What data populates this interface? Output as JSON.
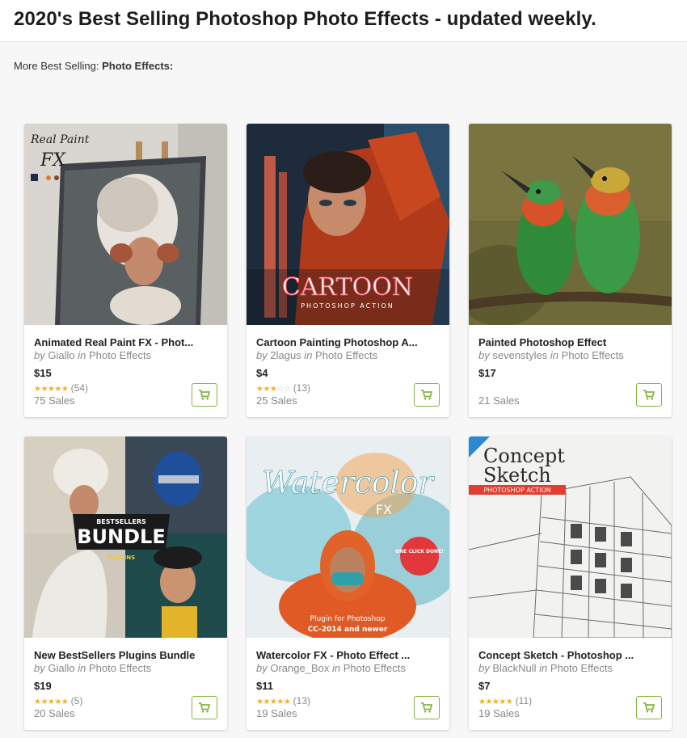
{
  "header": {
    "title": "2020's Best Selling Photoshop Photo Effects - updated weekly."
  },
  "breadcrumb": {
    "prefix": "More Best Selling:",
    "category": "Photo Effects:"
  },
  "colors": {
    "accent_green": "#82b541",
    "star": "#f0b323"
  },
  "products": [
    {
      "title": "Animated Real Paint FX - Phot...",
      "by_word": "by",
      "author": "Giallo",
      "in_word": "in",
      "category": "Photo Effects",
      "price": "$15",
      "stars": "★★★★★",
      "stars_off": "",
      "rating_count": "(54)",
      "sales": "75 Sales",
      "image_text": [
        "Real Paint",
        "FX"
      ]
    },
    {
      "title": "Cartoon Painting Photoshop A...",
      "by_word": "by",
      "author": "2lagus",
      "in_word": "in",
      "category": "Photo Effects",
      "price": "$4",
      "stars": "★★★",
      "stars_off": "☆☆",
      "rating_count": "(13)",
      "sales": "25 Sales",
      "image_text": [
        "CARTOON",
        "PHOTOSHOP ACTION"
      ]
    },
    {
      "title": "Painted Photoshop Effect",
      "by_word": "by",
      "author": "sevenstyles",
      "in_word": "in",
      "category": "Photo Effects",
      "price": "$17",
      "stars": "",
      "stars_off": "",
      "rating_count": "",
      "sales": "21 Sales",
      "image_text": []
    },
    {
      "title": "New BestSellers Plugins Bundle",
      "by_word": "by",
      "author": "Giallo",
      "in_word": "in",
      "category": "Photo Effects",
      "price": "$19",
      "stars": "★★★★★",
      "stars_off": "",
      "rating_count": "(5)",
      "sales": "20 Sales",
      "image_text": [
        "BESTSELLERS",
        "BUNDLE",
        "PLUGINS"
      ]
    },
    {
      "title": "Watercolor FX - Photo Effect ...",
      "by_word": "by",
      "author": "Orange_Box",
      "in_word": "in",
      "category": "Photo Effects",
      "price": "$11",
      "stars": "★★★★★",
      "stars_off": "",
      "rating_count": "(13)",
      "sales": "19 Sales",
      "image_text": [
        "Watercolor",
        "FX",
        "ONE CLICK DONE!",
        "Plugin for Photoshop",
        "CC-2014 and newer"
      ]
    },
    {
      "title": "Concept Sketch - Photoshop ...",
      "by_word": "by",
      "author": "BlackNull",
      "in_word": "in",
      "category": "Photo Effects",
      "price": "$7",
      "stars": "★★★★★",
      "stars_off": "",
      "rating_count": "(11)",
      "sales": "19 Sales",
      "image_text": [
        "Concept",
        "Sketch",
        "PHOTOSHOP ACTION"
      ]
    }
  ]
}
